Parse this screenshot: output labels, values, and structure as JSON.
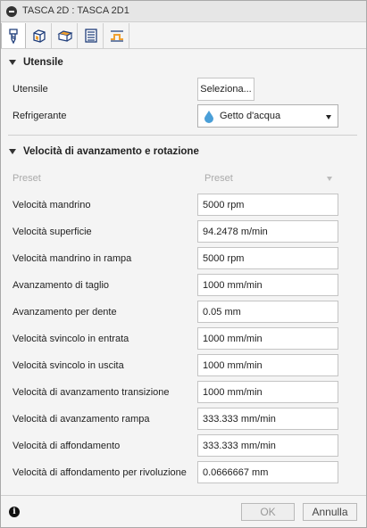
{
  "window": {
    "title": "TASCA 2D : TASCA 2D1"
  },
  "tabs": [
    {
      "icon": "tool-icon"
    },
    {
      "icon": "geometry-icon"
    },
    {
      "icon": "heights-icon"
    },
    {
      "icon": "passes-icon"
    },
    {
      "icon": "linking-icon"
    }
  ],
  "tool_section": {
    "header": "Utensile",
    "tool_label": "Utensile",
    "select_button": "Seleziona...",
    "coolant_label": "Refrigerante",
    "coolant_value": "Getto d'acqua",
    "coolant_icon": "water-drop-icon"
  },
  "feed_section": {
    "header": "Velocità di avanzamento e rotazione",
    "preset_label": "Preset",
    "preset_value": "Preset",
    "fields": [
      {
        "label": "Velocità mandrino",
        "value": "5000 rpm"
      },
      {
        "label": "Velocità superficie",
        "value": "94.2478 m/min"
      },
      {
        "label": "Velocità mandrino in rampa",
        "value": "5000 rpm"
      },
      {
        "label": "Avanzamento di taglio",
        "value": "1000 mm/min"
      },
      {
        "label": "Avanzamento per dente",
        "value": "0.05 mm"
      },
      {
        "label": "Velocità svincolo in entrata",
        "value": "1000 mm/min"
      },
      {
        "label": "Velocità svincolo in uscita",
        "value": "1000 mm/min"
      },
      {
        "label": "Velocità di avanzamento transizione",
        "value": "1000 mm/min"
      },
      {
        "label": "Velocità di avanzamento rampa",
        "value": "333.333 mm/min"
      },
      {
        "label": "Velocità di affondamento",
        "value": "333.333 mm/min"
      },
      {
        "label": "Velocità di affondamento per rivoluzione",
        "value": "0.0666667 mm"
      }
    ]
  },
  "footer": {
    "info_icon": "info-icon",
    "ok_label": "OK",
    "cancel_label": "Annulla"
  },
  "colors": {
    "coolant_drop": "#4a9fd8",
    "tab_icon_orange": "#f0a030",
    "tab_icon_blue": "#1f3d7a"
  }
}
